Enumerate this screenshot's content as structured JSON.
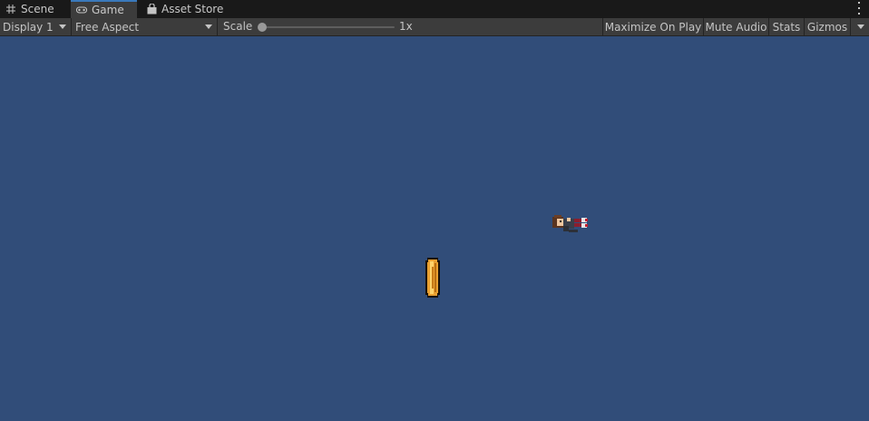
{
  "tabs": [
    {
      "label": "Scene",
      "icon": "grid-icon"
    },
    {
      "label": "Game",
      "icon": "gamepad-icon"
    },
    {
      "label": "Asset Store",
      "icon": "shopping-bag-icon"
    }
  ],
  "active_tab": "Game",
  "toolbar": {
    "display_label": "Display 1",
    "aspect_label": "Free Aspect",
    "scale_label": "Scale",
    "scale_value": "1x",
    "scale_slider_fraction": 0,
    "maximize_label": "Maximize On Play",
    "mute_label": "Mute Audio",
    "stats_label": "Stats",
    "gizmos_label": "Gizmos"
  },
  "game": {
    "background_color": "#314d79",
    "sprites": [
      "player-character-icon",
      "gold-coin-icon"
    ]
  },
  "colors": {
    "accent": "#3a79bb",
    "toolbar_bg": "#3c3c3c",
    "tabbar_bg": "#191919"
  }
}
